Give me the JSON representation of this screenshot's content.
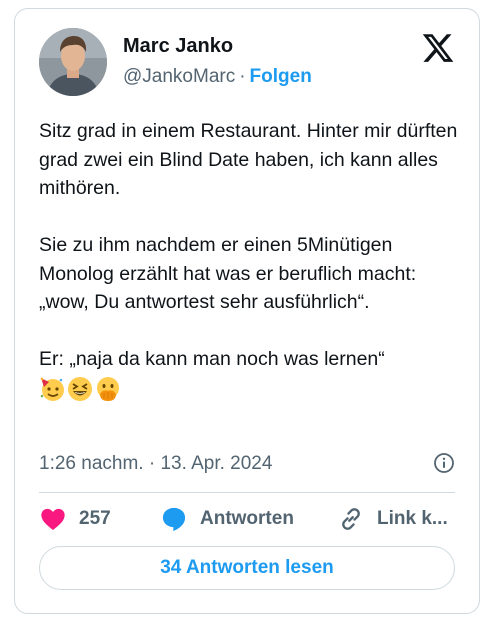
{
  "author": {
    "name": "Marc Janko",
    "handle": "@JankoMarc",
    "separator": "·",
    "follow_label": "Folgen"
  },
  "tweet": {
    "paragraphs": [
      "Sitz grad in einem Restaurant. Hinter mir dürften grad zwei ein Blind Date haben, ich kann alles mithören.",
      "Sie zu ihm nachdem er einen 5Minütigen Monolog erzählt hat was er beruflich macht: „wow, Du antwortest sehr ausführlich“.",
      "Er: „naja da kann man noch was lernen“"
    ],
    "emojis": [
      "partying-face-emoji",
      "grinning-squinting-face-emoji",
      "face-with-hand-over-mouth-emoji"
    ],
    "timestamp": "1:26 nachm. · 13. Apr. 2024"
  },
  "actions": {
    "like_count": "257",
    "reply_label": "Antworten",
    "copy_label": "Link k..."
  },
  "read_replies_label": "34 Antworten lesen",
  "icons": {
    "logo": "x-logo-icon",
    "info": "info-icon",
    "like": "heart-icon",
    "reply": "speech-bubble-icon",
    "copy": "link-icon"
  },
  "colors": {
    "accent": "#1d9bf0",
    "like": "#f91880",
    "text": "#0f1419",
    "secondary": "#536471",
    "border": "#cfd9de"
  }
}
